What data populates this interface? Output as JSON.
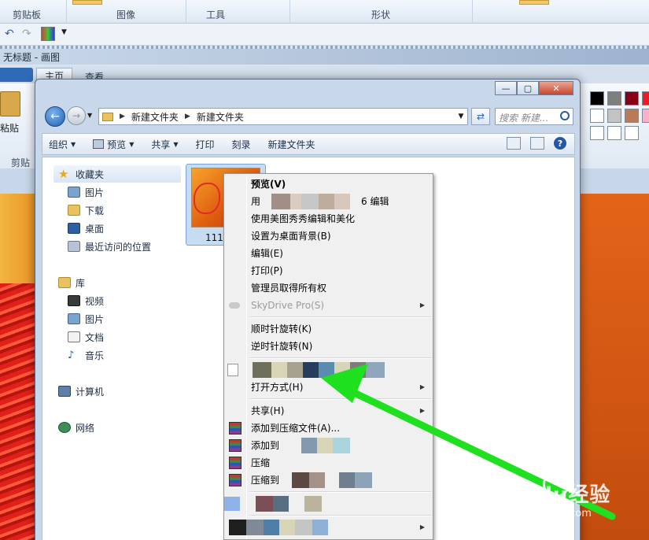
{
  "paint": {
    "ribbon_groups": [
      "剪贴板",
      "图像",
      "工具",
      "形状"
    ],
    "window_title": "无标题 - 画图",
    "tabs": [
      "主页",
      "查看"
    ],
    "paste_label": "粘贴",
    "clipboard_label": "剪贴"
  },
  "explorer": {
    "breadcrumb": [
      "新建文件夹",
      "新建文件夹"
    ],
    "search_placeholder": "搜索 新建...",
    "toolbar": [
      "组织",
      "预览",
      "共享",
      "打印",
      "刻录",
      "新建文件夹"
    ],
    "nav": {
      "favorites": "收藏夹",
      "fav_items": [
        "图片",
        "下载",
        "桌面",
        "最近访问的位置"
      ],
      "libraries": "库",
      "lib_items": [
        "视频",
        "图片",
        "文档",
        "音乐"
      ],
      "computer": "计算机",
      "network": "网络"
    },
    "file": {
      "name": "1111."
    }
  },
  "context_menu": {
    "preview": "预览(V)",
    "open_with_prefix": "用",
    "open_with_suffix": "6 编辑",
    "meitu": "使用美图秀秀编辑和美化",
    "set_bg": "设置为桌面背景(B)",
    "edit": "编辑(E)",
    "print": "打印(P)",
    "take_owner": "管理员取得所有权",
    "skydrive": "SkyDrive Pro(S)",
    "rotate_cw": "顺时针旋转(K)",
    "rotate_ccw": "逆时针旋转(N)",
    "open_method": "打开方式(H)",
    "share": "共享(H)",
    "add_archive": "添加到压缩文件(A)...",
    "add_to": "添加到",
    "compress": "压缩",
    "compress_to": "压缩到"
  },
  "watermark": {
    "brand": "Baidu经验",
    "url": "jingyan.baidu.com"
  },
  "colors": {
    "accent": "#2f6ab8",
    "arrow": "#1fe01f",
    "canvas": "#d9580f"
  }
}
